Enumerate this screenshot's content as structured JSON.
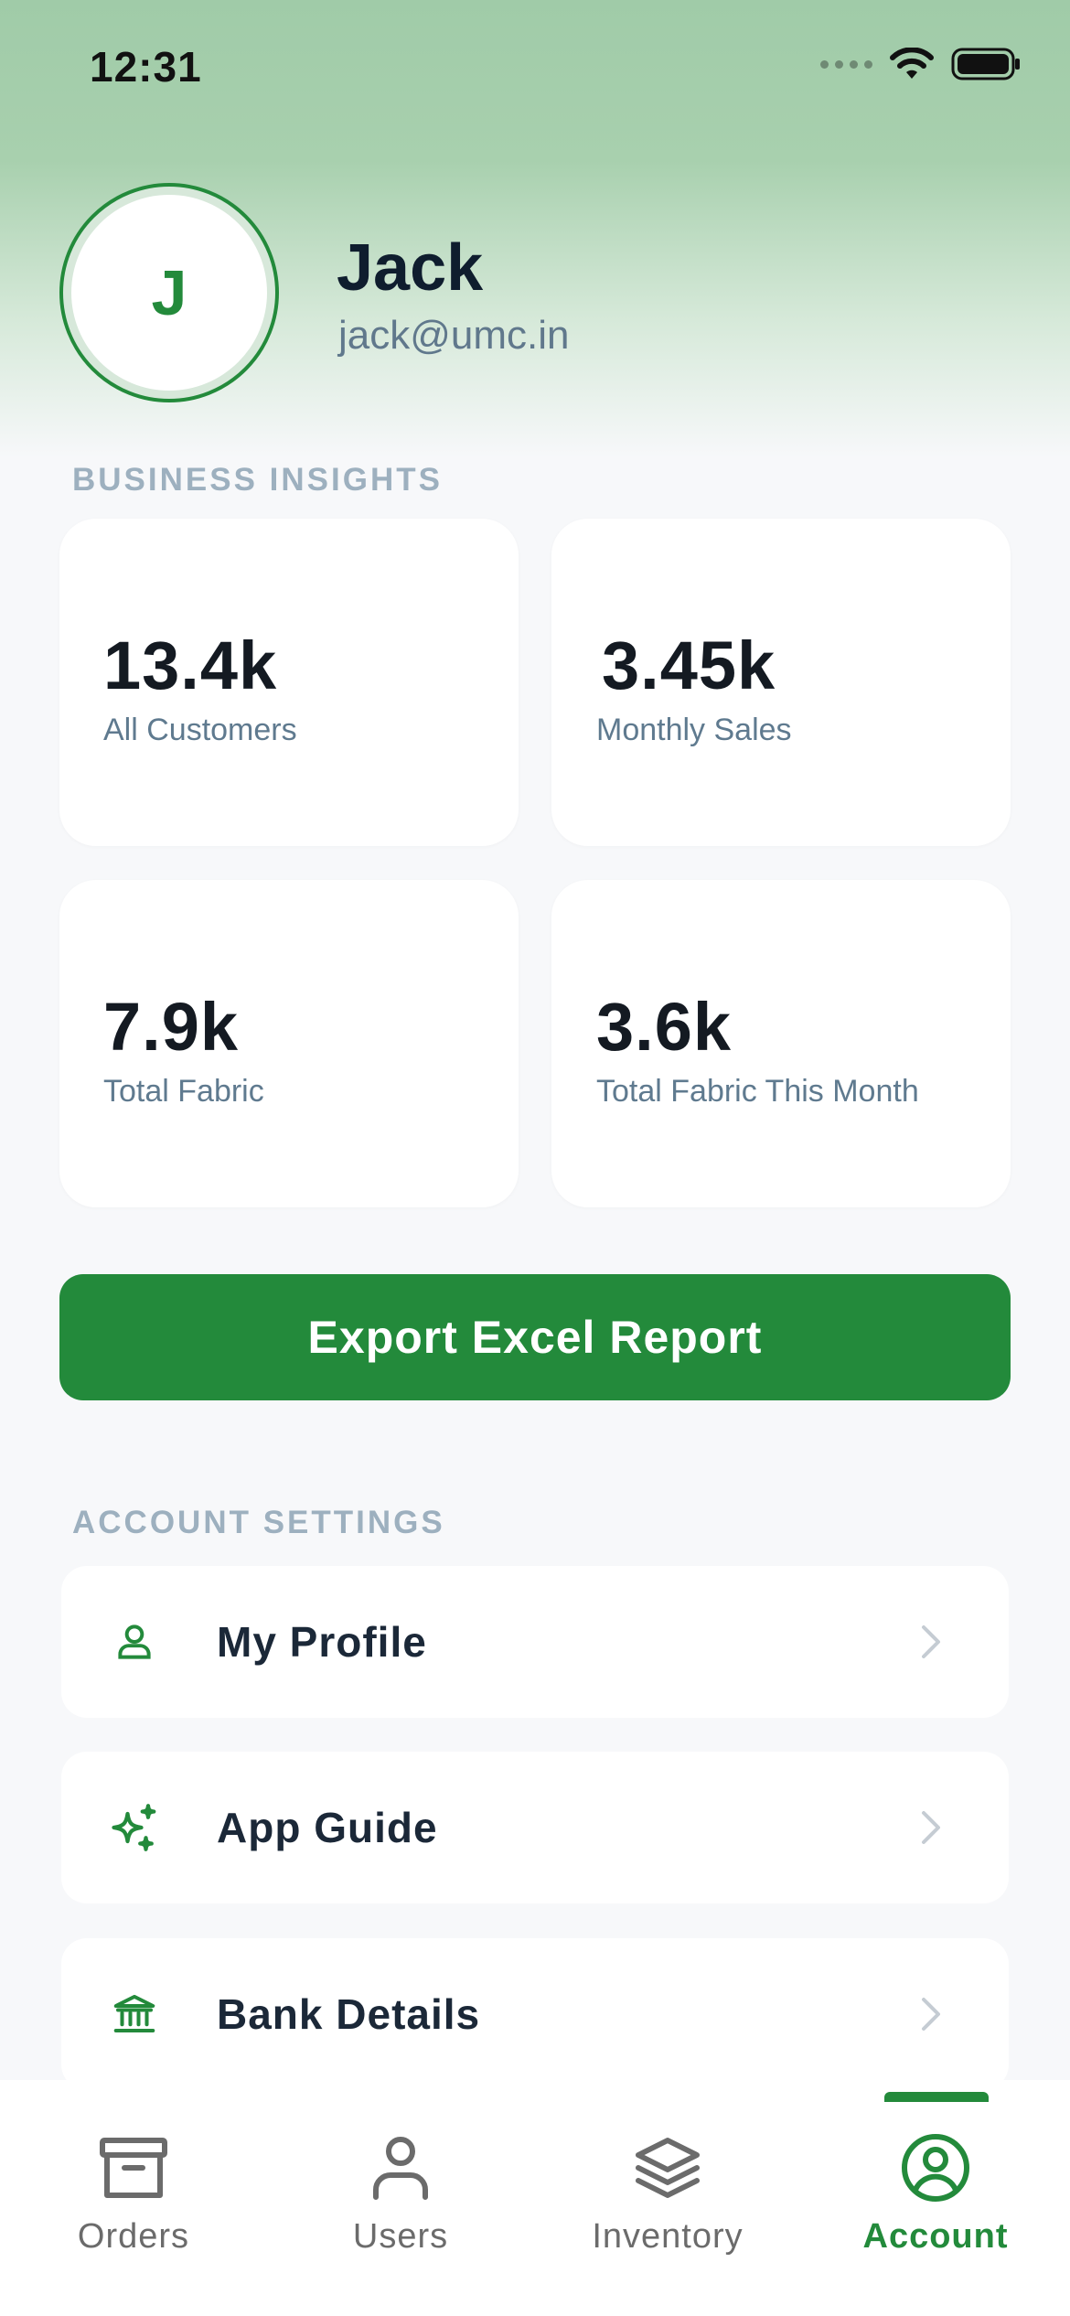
{
  "status_bar": {
    "time": "12:31"
  },
  "profile": {
    "initial": "J",
    "name": "Jack",
    "email": "jack@umc.in"
  },
  "insights": {
    "section_title": "BUSINESS INSIGHTS",
    "cards": [
      {
        "value": "13.4k",
        "label": "All Customers"
      },
      {
        "value": "3.45k",
        "label": "Monthly Sales"
      },
      {
        "value": "7.9k",
        "label": "Total Fabric"
      },
      {
        "value": "3.6k",
        "label": "Total Fabric This Month"
      }
    ]
  },
  "export_button": {
    "label": "Export Excel Report"
  },
  "settings": {
    "section_title": "ACCOUNT SETTINGS",
    "items": [
      {
        "label": "My Profile",
        "icon": "person-icon"
      },
      {
        "label": "App Guide",
        "icon": "sparkles-icon"
      },
      {
        "label": "Bank Details",
        "icon": "bank-icon"
      }
    ]
  },
  "tabbar": {
    "tabs": [
      {
        "label": "Orders",
        "icon": "archive-box-icon"
      },
      {
        "label": "Users",
        "icon": "user-icon"
      },
      {
        "label": "Inventory",
        "icon": "layers-icon"
      },
      {
        "label": "Account",
        "icon": "account-circle-icon",
        "active": true
      }
    ]
  },
  "colors": {
    "brand_green": "#238a3b",
    "header_green": "#a0cba8"
  }
}
